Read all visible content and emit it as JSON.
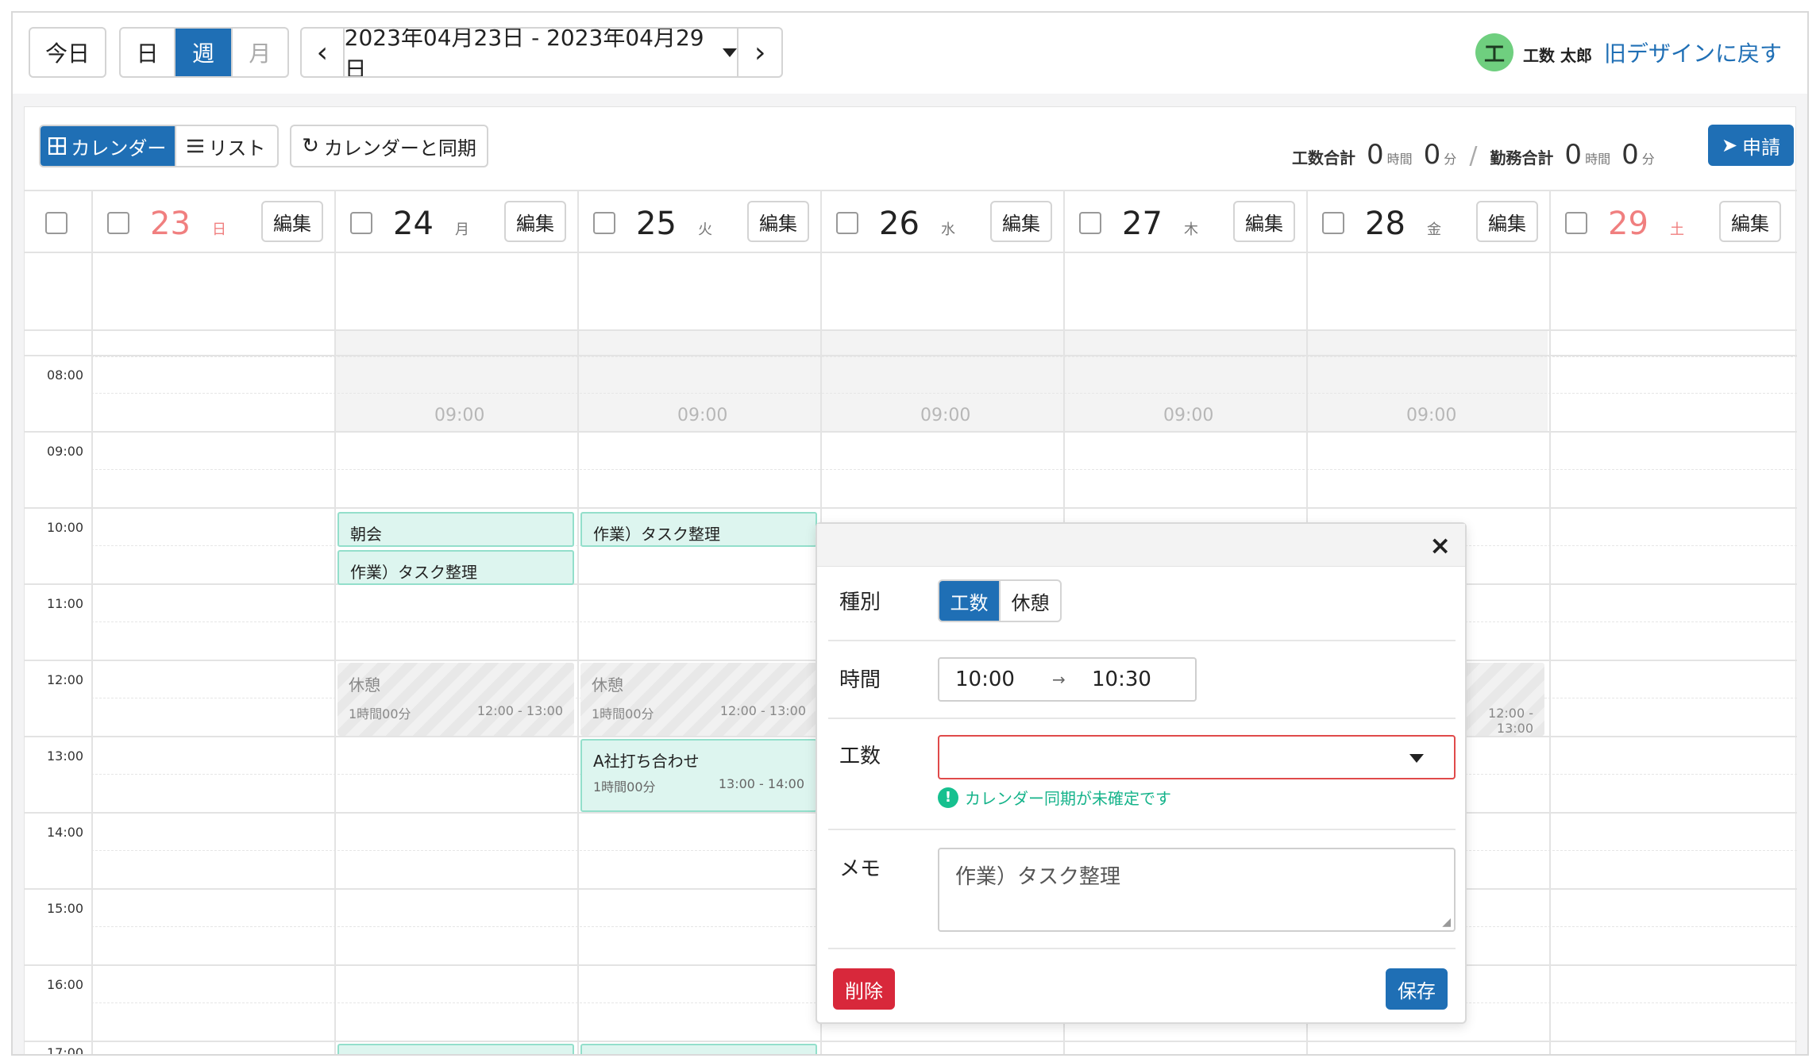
{
  "toolbar": {
    "today": "今日",
    "views": [
      "日",
      "週",
      "月"
    ],
    "active_view": "週",
    "prev_icon": "‹",
    "next_icon": "›",
    "date_range": "2023年04月23日 - 2023年04月29日",
    "user_avatar": "工",
    "user_name": "工数 太郎",
    "old_design_link": "旧デザインに戻す"
  },
  "panel": {
    "tabs": [
      "カレンダー",
      "リスト"
    ],
    "active_tab": "カレンダー",
    "sync_button": "カレンダーと同期",
    "summary": {
      "kosu_label": "工数合計",
      "kosu_hours": "0",
      "kosu_minutes": "0",
      "kinmu_label": "勤務合計",
      "kinmu_hours": "0",
      "kinmu_minutes": "0",
      "hour_unit": "時間",
      "minute_unit": "分",
      "separator": "/"
    },
    "apply_button": "申請"
  },
  "days": [
    {
      "num": "23",
      "weekday": "日",
      "holiday": true,
      "edit": "編集"
    },
    {
      "num": "24",
      "weekday": "月",
      "holiday": false,
      "edit": "編集"
    },
    {
      "num": "25",
      "weekday": "火",
      "holiday": false,
      "edit": "編集"
    },
    {
      "num": "26",
      "weekday": "水",
      "holiday": false,
      "edit": "編集"
    },
    {
      "num": "27",
      "weekday": "木",
      "holiday": false,
      "edit": "編集"
    },
    {
      "num": "28",
      "weekday": "金",
      "holiday": false,
      "edit": "編集"
    },
    {
      "num": "29",
      "weekday": "土",
      "holiday": true,
      "edit": "編集"
    }
  ],
  "time_labels": [
    "08:00",
    "09:00",
    "10:00",
    "11:00",
    "12:00",
    "13:00",
    "14:00",
    "15:00",
    "16:00",
    "17:00"
  ],
  "offhours_text": "09:00",
  "events": {
    "mon_1": {
      "title": "朝会"
    },
    "mon_2": {
      "title": "作業）タスク整理"
    },
    "tue_1": {
      "title": "作業）タスク整理"
    },
    "break": {
      "title": "休憩",
      "duration": "1時間00分",
      "range": "12:00 - 13:00"
    },
    "tue_meeting": {
      "title": "A社打ち合わせ",
      "duration": "1時間00分",
      "range": "13:00 - 14:00"
    }
  },
  "modal": {
    "close_icon": "×",
    "type_label": "種別",
    "type_options": [
      "工数",
      "休憩"
    ],
    "type_selected": "工数",
    "time_label": "時間",
    "time_start": "10:00",
    "time_arrow": "→",
    "time_end": "10:30",
    "kosu_label": "工数",
    "kosu_value": "",
    "hint": "カレンダー同期が未確定です",
    "hint_icon": "!",
    "memo_label": "メモ",
    "memo_value": "作業）タスク整理",
    "delete_button": "削除",
    "save_button": "保存"
  },
  "colors": {
    "accent": "#1f6fb5",
    "holiday": "#f07f7f",
    "event_bg": "#ddf5ef",
    "danger": "#d8283b",
    "hint": "#15b38a"
  }
}
